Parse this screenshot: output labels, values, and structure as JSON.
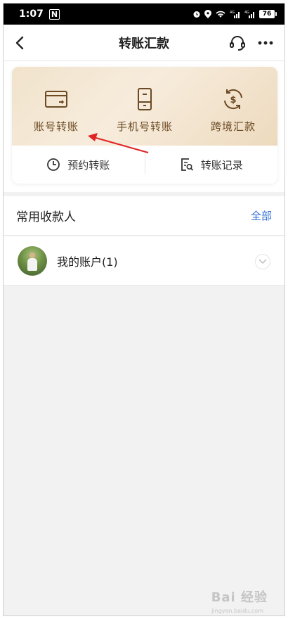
{
  "status_bar": {
    "time": "1:07",
    "nfc_icon": "N",
    "battery": "76"
  },
  "nav": {
    "title": "转账汇款"
  },
  "quick_actions": [
    {
      "label": "账号转账",
      "icon": "card-icon"
    },
    {
      "label": "手机号转账",
      "icon": "phone-icon"
    },
    {
      "label": "跨境汇款",
      "icon": "dollar-exchange-icon"
    }
  ],
  "sub_actions": [
    {
      "label": "预约转账",
      "icon": "clock-icon"
    },
    {
      "label": "转账记录",
      "icon": "record-search-icon"
    }
  ],
  "payees": {
    "title": "常用收款人",
    "all_label": "全部",
    "items": [
      {
        "name": "我的账户(1)"
      }
    ]
  },
  "watermark": {
    "text": "Bai 经验",
    "sub": "jingyan.baidu.com"
  },
  "colors": {
    "card_gold": "#f1e3cc",
    "label_brown": "#6b4a24",
    "link_blue": "#2f6fd6",
    "arrow_red": "#e02424"
  }
}
